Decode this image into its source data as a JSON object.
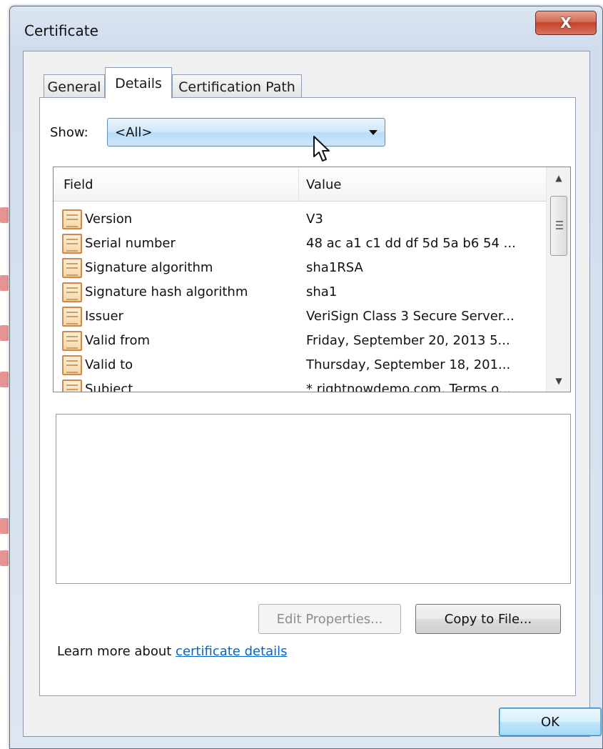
{
  "window": {
    "title": "Certificate",
    "close_label": "X"
  },
  "tabs": [
    {
      "label": "General"
    },
    {
      "label": "Details"
    },
    {
      "label": "Certification Path"
    }
  ],
  "show": {
    "label": "Show:",
    "selected": "<All>"
  },
  "list": {
    "columns": [
      "Field",
      "Value"
    ],
    "rows": [
      {
        "field": "Version",
        "value": "V3"
      },
      {
        "field": "Serial number",
        "value": "48 ac a1 c1 dd df 5d 5a b6 54 ..."
      },
      {
        "field": "Signature algorithm",
        "value": "sha1RSA"
      },
      {
        "field": "Signature hash algorithm",
        "value": "sha1"
      },
      {
        "field": "Issuer",
        "value": "VeriSign Class 3 Secure Server..."
      },
      {
        "field": "Valid from",
        "value": "Friday, September 20, 2013 5..."
      },
      {
        "field": "Valid to",
        "value": "Thursday, September 18, 201..."
      },
      {
        "field": "Subject",
        "value": "* rightnowdemo.com, Terms o..."
      }
    ]
  },
  "buttons": {
    "edit_properties": "Edit Properties...",
    "copy_to_file": "Copy to File...",
    "ok": "OK"
  },
  "learn_more": {
    "prefix": "Learn more about ",
    "link": "certificate details"
  },
  "icons": {
    "field_row": "certificate-field-icon",
    "cursor": "mouse-pointer-icon",
    "dropdown": "chevron-down-icon"
  },
  "colors": {
    "link": "#0066cc",
    "close_button": "#c4422a",
    "select_highlight": "#cce6fa"
  }
}
